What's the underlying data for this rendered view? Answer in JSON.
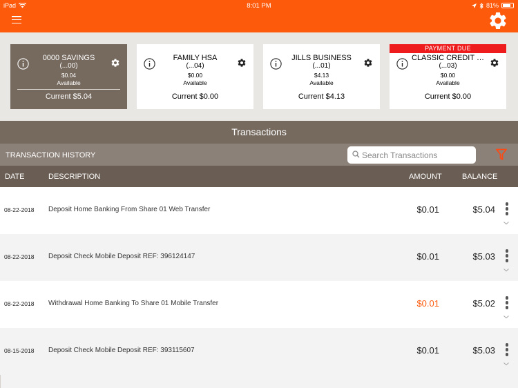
{
  "status_bar": {
    "device": "iPad",
    "time": "8:01 PM",
    "battery": "81%",
    "battery_level": 0.81
  },
  "header": {
    "menu_icon": "hamburger-icon",
    "settings_icon": "gear-icon",
    "brand_color": "#fd5a0c"
  },
  "accounts": [
    {
      "name": "0000 SAVINGS",
      "number": "(...00)",
      "balance": "$0.04",
      "available_label": "Available",
      "current": "Current $5.04",
      "badge": "",
      "selected": true
    },
    {
      "name": "FAMILY HSA",
      "number": "(...04)",
      "balance": "$0.00",
      "available_label": "Available",
      "current": "Current $0.00",
      "badge": "",
      "selected": false
    },
    {
      "name": "JILLS BUSINESS",
      "number": "(...01)",
      "balance": "$4.13",
      "available_label": "Available",
      "current": "Current $4.13",
      "badge": "",
      "selected": false
    },
    {
      "name": "CLASSIC CREDIT C...",
      "number": "(...03)",
      "balance": "$0.00",
      "available_label": "Available",
      "current": "Current $0.00",
      "badge": "PAYMENT DUE",
      "selected": false
    }
  ],
  "transactions": {
    "title": "Transactions",
    "history_label": "TRANSACTION HISTORY",
    "search_placeholder": "Search Transactions",
    "columns": {
      "date": "DATE",
      "description": "DESCRIPTION",
      "amount": "AMOUNT",
      "balance": "BALANCE"
    },
    "rows": [
      {
        "date": "08-22-2018",
        "description": "Deposit Home Banking From Share 01 Web Transfer",
        "amount": "$0.01",
        "balance": "$5.04",
        "withdrawal": false
      },
      {
        "date": "08-22-2018",
        "description": "Deposit Check Mobile Deposit REF: 396124147",
        "amount": "$0.01",
        "balance": "$5.03",
        "withdrawal": false
      },
      {
        "date": "08-22-2018",
        "description": "Withdrawal Home Banking To Share 01 Mobile Transfer",
        "amount": "$0.01",
        "balance": "$5.02",
        "withdrawal": true
      },
      {
        "date": "08-15-2018",
        "description": "Deposit Check Mobile Deposit REF: 393115607",
        "amount": "$0.01",
        "balance": "$5.03",
        "withdrawal": false
      }
    ]
  }
}
